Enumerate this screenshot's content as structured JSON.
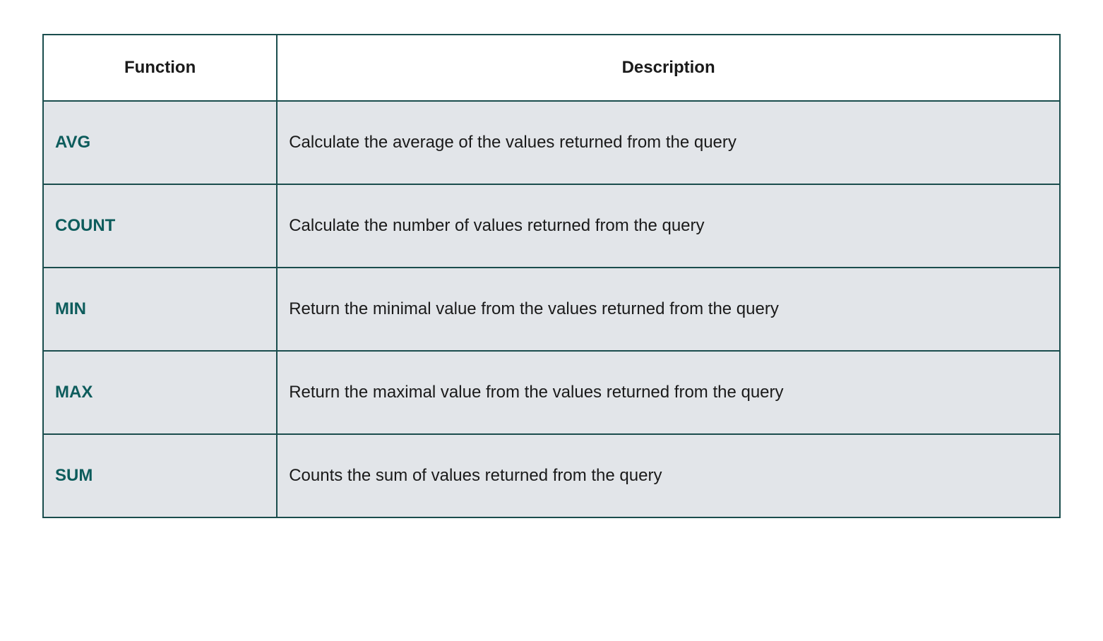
{
  "headers": {
    "function": "Function",
    "description": "Description"
  },
  "rows": [
    {
      "function": "AVG",
      "description": "Calculate the average of the values returned from the query"
    },
    {
      "function": "COUNT",
      "description": "Calculate the number of values returned from the query"
    },
    {
      "function": "MIN",
      "description": "Return the minimal value from the values returned from the query"
    },
    {
      "function": "MAX",
      "description": "Return the maximal value from the values returned from the query"
    },
    {
      "function": "SUM",
      "description": "Counts the sum of values returned from the query"
    }
  ]
}
